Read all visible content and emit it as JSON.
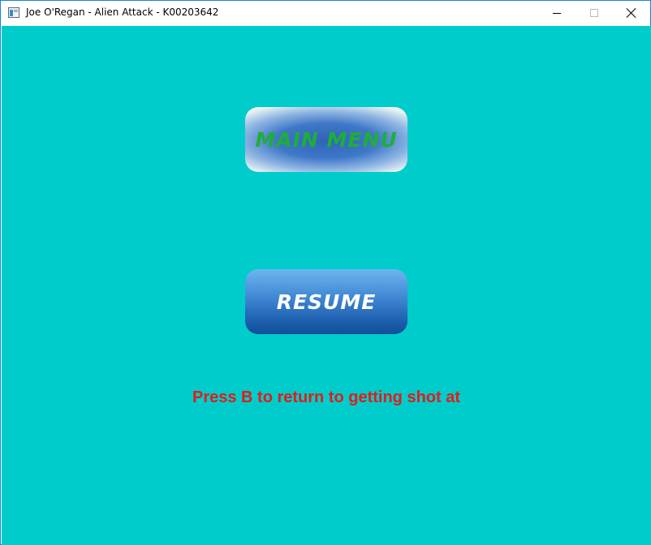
{
  "window": {
    "title": "Joe O'Regan - Alien Attack - K00203642",
    "app_icon": "window-app-icon",
    "controls": {
      "minimize_icon": "minimize-icon",
      "maximize_icon": "maximize-icon",
      "close_icon": "close-icon"
    }
  },
  "game": {
    "background_color": "#00cccc",
    "buttons": {
      "main_menu_label": "MAIN MENU",
      "resume_label": "RESUME"
    },
    "hint_text": "Press B to return to getting shot at",
    "hint_color": "#dd1f1a"
  }
}
